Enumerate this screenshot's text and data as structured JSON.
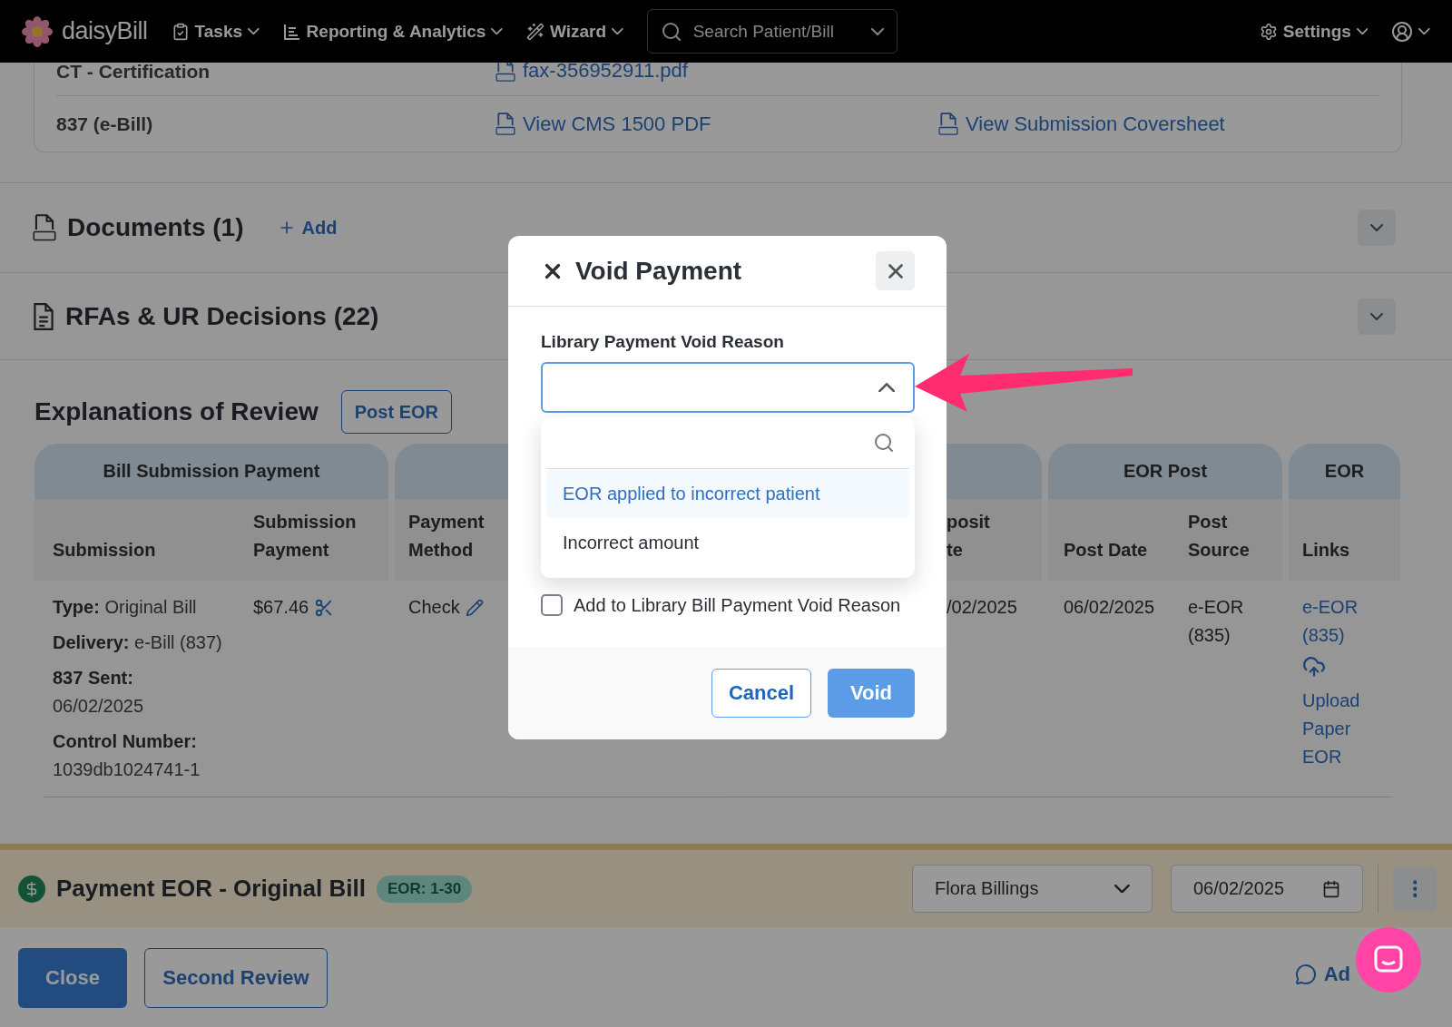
{
  "nav": {
    "brand": "daisyBill",
    "menus": [
      {
        "kind": "tasks",
        "label": "Tasks"
      },
      {
        "kind": "reports",
        "label": "Reporting & Analytics"
      },
      {
        "kind": "wizard",
        "label": "Wizard"
      }
    ],
    "search": {
      "placeholder": "Search Patient/Bill"
    },
    "settings": "Settings"
  },
  "submission_card": {
    "rows": [
      {
        "label": "CT - Certification",
        "links": [
          "fax-356952911.pdf"
        ]
      },
      {
        "label": "837 (e-Bill)",
        "links": [
          "View CMS 1500 PDF",
          "View Submission Coversheet"
        ]
      }
    ]
  },
  "sections": [
    {
      "kind": "pdf",
      "title": "Documents (1)",
      "add": "Add"
    },
    {
      "kind": "doc",
      "title": "RFAs & UR Decisions (22)"
    }
  ],
  "eor": {
    "title": "Explanations of Review",
    "post_button": "Post EOR",
    "groups": [
      {
        "label": "Bill Submission Payment",
        "columns": [
          "Submission",
          "Submission Payment"
        ]
      },
      {
        "columns": [
          "Payment Method"
        ]
      },
      {
        "columns": [
          "posit\nte"
        ]
      },
      {
        "label": "EOR Post",
        "columns": [
          "Post Date",
          "Post Source"
        ]
      },
      {
        "label": "EOR",
        "columns": [
          "Links"
        ]
      }
    ],
    "row": {
      "submission": [
        {
          "kind": "inline",
          "key": "Type:",
          "value": "Original Bill"
        },
        {
          "kind": "inline",
          "key": "Delivery:",
          "value": "e-Bill (837)"
        },
        {
          "kind": "stacked",
          "key": "837 Sent:",
          "value": "06/02/2025"
        },
        {
          "kind": "stacked",
          "key": "Control Number:",
          "value": "1039db1024741-1"
        }
      ],
      "payment": "$67.46",
      "method": "Check",
      "deposit": "/02/2025",
      "post_date": "06/02/2025",
      "post_source": "e-EOR (835)",
      "links": [
        "e-EOR (835)",
        "Upload Paper EOR"
      ]
    }
  },
  "payment_bar": {
    "title": "Payment EOR - Original Bill",
    "badge": "EOR: 1-30",
    "assignee": "Flora Billings",
    "date": "06/02/2025"
  },
  "footer": {
    "close": "Close",
    "second_review": "Second Review",
    "add_note": "Ad"
  },
  "modal": {
    "title": "Void Payment",
    "field_label": "Library Payment Void Reason",
    "expanded": true,
    "options": [
      {
        "label": "EOR applied to incorrect patient",
        "selected": true
      },
      {
        "label": "Incorrect amount",
        "selected": false
      }
    ],
    "checkbox": {
      "label": "Add to Library Bill Payment Void Reason",
      "checked": false
    },
    "cancel": "Cancel",
    "void": "Void"
  }
}
